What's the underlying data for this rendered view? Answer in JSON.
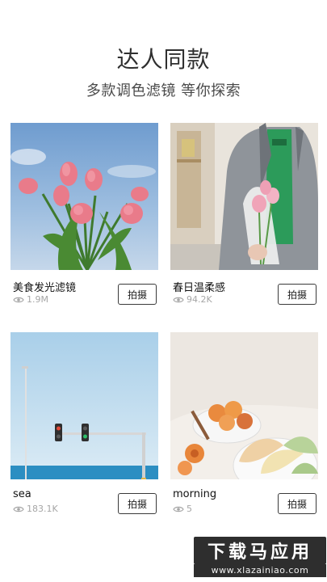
{
  "header": {
    "title": "达人同款",
    "subtitle": "多款调色滤镜 等你探索"
  },
  "filters": [
    {
      "name": "美食发光滤镜",
      "views": "1.9M",
      "button": "拍摄",
      "image": "pink-tulips-blue-sky"
    },
    {
      "name": "春日温柔感",
      "views": "94.2K",
      "button": "拍摄",
      "image": "person-holding-tulips"
    },
    {
      "name": "sea",
      "views": "183.1K",
      "button": "拍摄",
      "image": "sea-traffic-light"
    },
    {
      "name": "morning",
      "views": "5",
      "button": "拍摄",
      "image": "peach-melon-plate"
    }
  ],
  "watermark": {
    "brand": "下载马应用",
    "url": "www.xlazainiao.com"
  },
  "icons": {
    "views": "eye-icon"
  },
  "colors": {
    "text": "#1c1c1c",
    "muted": "#a6a6a6",
    "border": "#3a3a3a"
  }
}
